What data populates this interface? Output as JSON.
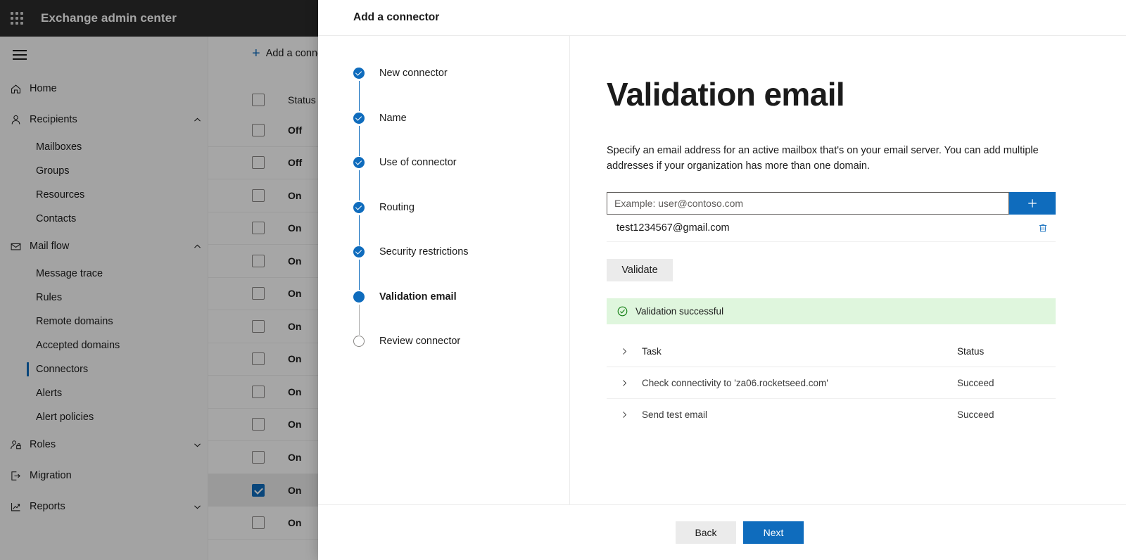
{
  "brand": {
    "waffle_icon": "waffle-icon",
    "title": "Exchange admin center"
  },
  "sidebar": {
    "hamburger_icon": "hamburger-icon",
    "items": [
      {
        "label": "Home",
        "icon": "home-icon",
        "type": "item",
        "chevron": ""
      },
      {
        "label": "Recipients",
        "icon": "person-icon",
        "type": "item",
        "chevron": "⌃"
      },
      {
        "label": "Mailboxes",
        "icon": "",
        "type": "sub",
        "chevron": ""
      },
      {
        "label": "Groups",
        "icon": "",
        "type": "sub",
        "chevron": ""
      },
      {
        "label": "Resources",
        "icon": "",
        "type": "sub",
        "chevron": ""
      },
      {
        "label": "Contacts",
        "icon": "",
        "type": "sub",
        "chevron": ""
      },
      {
        "label": "Mail flow",
        "icon": "mail-icon",
        "type": "item",
        "chevron": "⌃"
      },
      {
        "label": "Message trace",
        "icon": "",
        "type": "sub",
        "chevron": ""
      },
      {
        "label": "Rules",
        "icon": "",
        "type": "sub",
        "chevron": ""
      },
      {
        "label": "Remote domains",
        "icon": "",
        "type": "sub",
        "chevron": ""
      },
      {
        "label": "Accepted domains",
        "icon": "",
        "type": "sub",
        "chevron": ""
      },
      {
        "label": "Connectors",
        "icon": "",
        "type": "sub",
        "chevron": "",
        "selected": true
      },
      {
        "label": "Alerts",
        "icon": "",
        "type": "sub",
        "chevron": ""
      },
      {
        "label": "Alert policies",
        "icon": "",
        "type": "sub",
        "chevron": ""
      },
      {
        "label": "Roles",
        "icon": "roles-icon",
        "type": "item",
        "chevron": "⌄"
      },
      {
        "label": "Migration",
        "icon": "migration-icon",
        "type": "item",
        "chevron": ""
      },
      {
        "label": "Reports",
        "icon": "reports-icon",
        "type": "item",
        "chevron": "⌄"
      }
    ]
  },
  "background_list": {
    "command_bar": {
      "add_label": "Add a connector",
      "plus_icon": "plus-icon"
    },
    "column_header": "Status",
    "rows": [
      {
        "status": "Off",
        "checked": false
      },
      {
        "status": "Off",
        "checked": false
      },
      {
        "status": "On",
        "checked": false
      },
      {
        "status": "On",
        "checked": false
      },
      {
        "status": "On",
        "checked": false
      },
      {
        "status": "On",
        "checked": false
      },
      {
        "status": "On",
        "checked": false
      },
      {
        "status": "On",
        "checked": false
      },
      {
        "status": "On",
        "checked": false
      },
      {
        "status": "On",
        "checked": false
      },
      {
        "status": "On",
        "checked": false
      },
      {
        "status": "On",
        "checked": true
      },
      {
        "status": "On",
        "checked": false
      }
    ]
  },
  "panel": {
    "title": "Add a connector",
    "steps": [
      {
        "label": "New connector",
        "state": "done"
      },
      {
        "label": "Name",
        "state": "done"
      },
      {
        "label": "Use of connector",
        "state": "done"
      },
      {
        "label": "Routing",
        "state": "done"
      },
      {
        "label": "Security restrictions",
        "state": "done"
      },
      {
        "label": "Validation email",
        "state": "current"
      },
      {
        "label": "Review connector",
        "state": "pending"
      }
    ],
    "main": {
      "heading": "Validation email",
      "description": "Specify an email address for an active mailbox that's on your email server. You can add multiple addresses if your organization has more than one domain.",
      "email_placeholder": "Example: user@contoso.com",
      "email_value": "",
      "add_button_icon": "plus-icon",
      "added_emails": [
        {
          "address": "test1234567@gmail.com",
          "delete_icon": "trash-icon"
        }
      ],
      "validate_label": "Validate",
      "validation_banner": {
        "icon": "check-circle-icon",
        "message": "Validation successful",
        "background": "#dff6dd",
        "icon_color": "#107c10"
      },
      "task_table": {
        "expand_icon": "chevron-right-icon",
        "columns": {
          "task": "Task",
          "status": "Status"
        },
        "rows": [
          {
            "task": "Check connectivity to 'za06.rocketseed.com'",
            "status": "Succeed"
          },
          {
            "task": "Send test email",
            "status": "Succeed"
          }
        ]
      }
    },
    "footer": {
      "back_label": "Back",
      "next_label": "Next"
    }
  },
  "colors": {
    "brand_bar": "#2b2b2b",
    "accent": "#0f6cbd",
    "success_bg": "#dff6dd",
    "success_fg": "#107c10",
    "sidebar_bg": "#fafafa"
  }
}
